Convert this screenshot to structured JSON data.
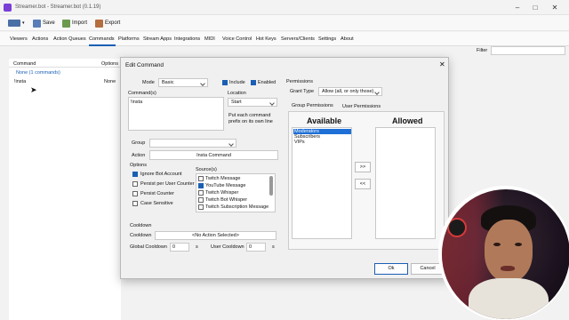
{
  "window": {
    "title": "Streamer.bot - Streamer.bot (0.1.19)"
  },
  "toolbar": {
    "save_label": "Save",
    "import_label": "Import",
    "export_label": "Export"
  },
  "menu": [
    "Viewers",
    "Actions",
    "Action Queues",
    "Commands",
    "Platforms",
    "Stream Apps",
    "Integrations",
    "MIDI",
    "Voice Control",
    "Hot Keys",
    "Servers/Clients",
    "Settings",
    "About"
  ],
  "filter_label": "Filter",
  "list": {
    "col_command": "Command",
    "col_options": "Options",
    "group_row": "None (1 commands)",
    "row_command": "!insta",
    "row_value": "None"
  },
  "dialog": {
    "title": "Edit Command",
    "mode_label": "Mode",
    "mode_value": "Basic",
    "include_label": "Include",
    "enabled_label": "Enabled",
    "commands_label": "Command(s)",
    "commands_value": "!insta",
    "location_label": "Location",
    "location_value": "Start",
    "location_hint": "Put each command prefix on its own line",
    "group_label": "Group",
    "action_label": "Action",
    "action_value": "Insta Command",
    "options_label": "Options",
    "options": [
      "Ignore Bot Account",
      "Persist per User Counter",
      "Persist Counter",
      "Case Sensitive"
    ],
    "sources_label": "Source(s)",
    "sources": [
      "Twitch Message",
      "YouTube Message",
      "Twitch Whisper",
      "Twitch Bot Whisper",
      "Twitch Subscription Message"
    ],
    "cooldown_section": "Cooldown",
    "cooldown_label": "Cooldown",
    "cooldown_value": "<No Action Selected>",
    "global_cooldown_label": "Global Cooldown",
    "global_cooldown_value": "0",
    "seconds_unit": "s",
    "user_cooldown_label": "User Cooldown",
    "user_cooldown_value": "0",
    "permissions_label": "Permissions",
    "grant_type_label": "Grant Type",
    "grant_type_value": "Allow (all, or only those)",
    "tab_group": "Group Permissions",
    "tab_user": "User Permissions",
    "available_header": "Available",
    "allowed_header": "Allowed",
    "available_items": [
      "Moderators",
      "Subscribers",
      "VIPs"
    ],
    "move_right": ">>",
    "move_left": "<<",
    "ok_label": "Ok",
    "cancel_label": "Cancel"
  },
  "colors": {
    "accent": "#1a5fb4",
    "selection": "#1e6fd6"
  }
}
